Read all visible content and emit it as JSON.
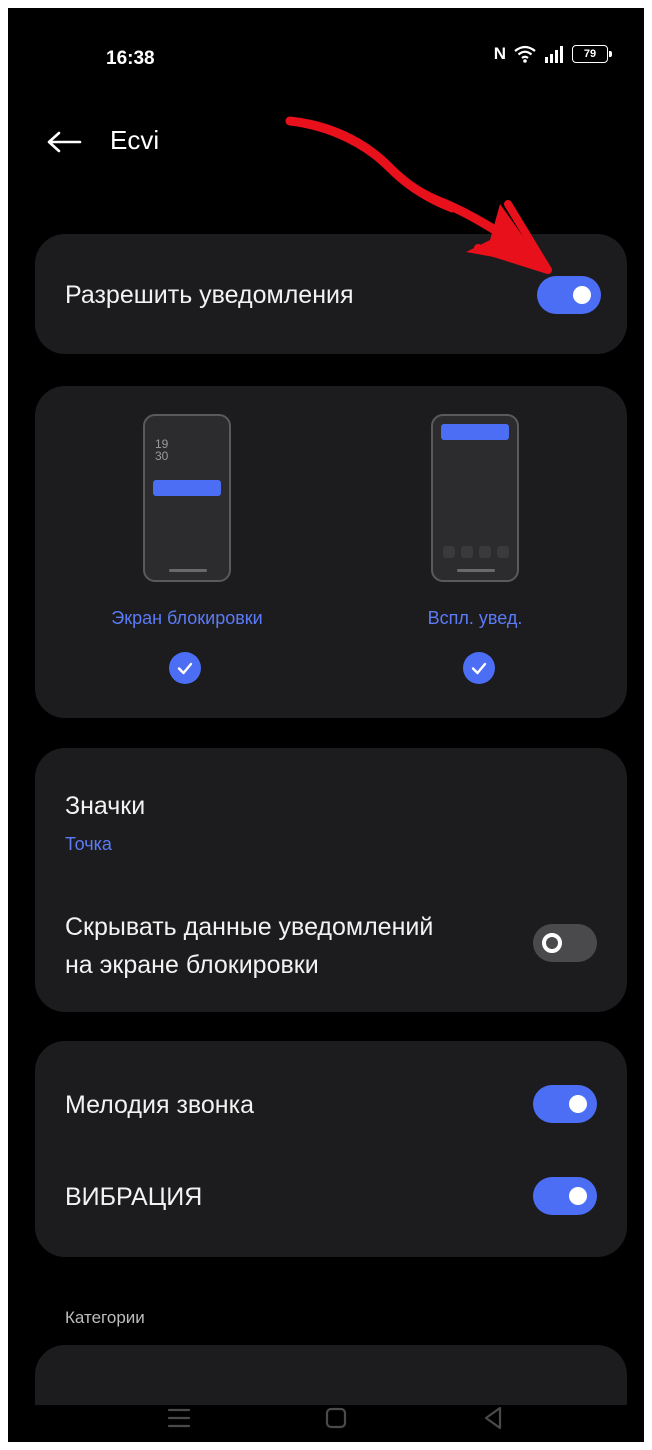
{
  "status_bar": {
    "time": "16:38",
    "nfc_icon": "N",
    "battery": "79",
    "icons": [
      "nfc-icon",
      "wifi-icon",
      "signal-icon",
      "battery-icon"
    ]
  },
  "header": {
    "title": "Ecvi",
    "back_icon": "arrow-left-icon"
  },
  "allow_card": {
    "label": "Разрешить уведомления",
    "toggle_on": true
  },
  "preview_card": {
    "lock_screen": {
      "label": "Экран блокировки",
      "clock_hours": "19",
      "clock_minutes": "30",
      "checked": true
    },
    "popup": {
      "label": "Вспл. увед.",
      "checked": true
    }
  },
  "badges_card": {
    "title": "Значки",
    "value": "Точка",
    "hide_line1": "Скрывать данные уведомлений",
    "hide_line2": "на экране блокировки",
    "hide_toggle_on": false
  },
  "sound_card": {
    "ringtone_label": "Мелодия звонка",
    "ringtone_on": true,
    "vibration_label": "ВИБРАЦИЯ",
    "vibration_on": true
  },
  "categories_caption": "Категории",
  "colors": {
    "accent": "#4c6ef5",
    "card_bg": "#1c1c1e",
    "annotation": "#e8101a"
  }
}
